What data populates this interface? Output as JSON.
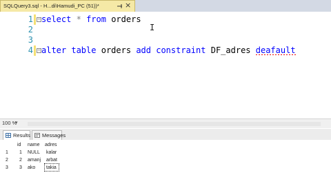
{
  "tab": {
    "title": "SQLQuery3.sql - H...di\\Hamudi_PC (51))*",
    "close_glyph": "×",
    "pin_icon": "pin-icon",
    "close_icon": "close-icon"
  },
  "editor": {
    "lines": [
      {
        "number": "1"
      },
      {
        "number": "2"
      },
      {
        "number": "3"
      },
      {
        "number": "4"
      }
    ],
    "line1": {
      "select": "select",
      "star": "*",
      "from": "from",
      "table": "orders"
    },
    "line4": {
      "alter": "alter",
      "table_kw": "table",
      "table": "orders",
      "add": "add",
      "constraint": "constraint",
      "name": "DF_adres",
      "default": "deafault"
    },
    "cursor_icon": "i-beam-cursor-icon"
  },
  "zoom": {
    "value": "100 %"
  },
  "results_tabs": [
    {
      "label": "Results",
      "icon": "grid-icon"
    },
    {
      "label": "Messages",
      "icon": "messages-icon"
    }
  ],
  "grid": {
    "columns": [
      "id",
      "name",
      "adres"
    ],
    "rows": [
      {
        "row_num": "1",
        "id": "1",
        "name": "NULL",
        "adres": "kalar"
      },
      {
        "row_num": "2",
        "id": "2",
        "name": "amanj",
        "adres": "arbat"
      },
      {
        "row_num": "3",
        "id": "3",
        "name": "ako",
        "adres": "takia"
      }
    ]
  }
}
